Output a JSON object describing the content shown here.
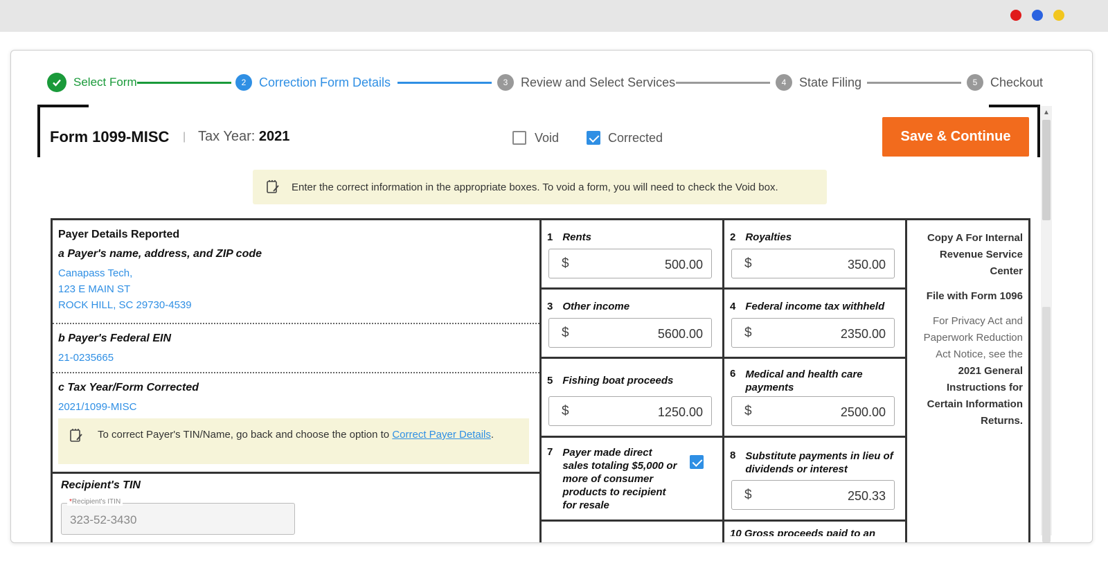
{
  "stepper": {
    "steps": [
      {
        "num": "1",
        "label": "Select Form"
      },
      {
        "num": "2",
        "label": "Correction Form Details"
      },
      {
        "num": "3",
        "label": "Review and Select Services"
      },
      {
        "num": "4",
        "label": "State Filing"
      },
      {
        "num": "5",
        "label": "Checkout"
      }
    ]
  },
  "header": {
    "form_title": "Form 1099-MISC",
    "separator": "|",
    "tax_year_label": "Tax Year:",
    "tax_year_value": "2021",
    "void_label": "Void",
    "corrected_label": "Corrected",
    "save_label": "Save & Continue"
  },
  "notice": "Enter the correct information in the appropriate boxes. To void a form, you will need to check the Void box.",
  "payer": {
    "section_title": "Payer Details Reported",
    "name_label": "a Payer's name, address, and ZIP code",
    "name_line1": "Canapass Tech,",
    "name_line2": "123 E MAIN ST",
    "name_line3": "ROCK HILL, SC 29730-4539",
    "ein_label": "b Payer's Federal EIN",
    "ein_value": "21-0235665",
    "corrected_label": "c Tax Year/Form Corrected",
    "corrected_value": "2021/1099-MISC",
    "tin_note_text": "To correct Payer's TIN/Name, go back and choose the option to",
    "tin_note_link": "Correct Payer Details",
    "tin_note_end": "."
  },
  "recipient": {
    "tin_label": "Recipient's TIN",
    "field_asterisk": "*",
    "field_label": "Recipient's ITIN",
    "field_value": "323-52-3430"
  },
  "boxes": {
    "currency": "$",
    "b1": {
      "num": "1",
      "label": "Rents",
      "value": "500.00"
    },
    "b2": {
      "num": "2",
      "label": "Royalties",
      "value": "350.00"
    },
    "b3": {
      "num": "3",
      "label": "Other income",
      "value": "5600.00"
    },
    "b4": {
      "num": "4",
      "label": "Federal income tax withheld",
      "value": "2350.00"
    },
    "b5": {
      "num": "5",
      "label": "Fishing boat proceeds",
      "value": "1250.00"
    },
    "b6": {
      "num": "6",
      "label": "Medical and health care payments",
      "value": "2500.00"
    },
    "b7": {
      "num": "7",
      "label": "Payer made direct sales totaling $5,000 or more of consumer products to recipient for resale",
      "checked": true
    },
    "b8": {
      "num": "8",
      "label": "Substitute payments in lieu of dividends or interest",
      "value": "250.33"
    },
    "b10": {
      "label": "10 Gross proceeds paid to an"
    }
  },
  "copy_panel": {
    "line1": "Copy A For Internal Revenue Service Center",
    "line2": "File with Form 1096",
    "line3a": "For Privacy Act and Paperwork Reduction Act Notice, see the",
    "line3b": "2021 General Instructions for Certain Information Returns."
  },
  "colors": {
    "accent_green": "#1a9a3a",
    "accent_blue": "#2f8fe4",
    "save_orange": "#f26b1d",
    "notice_bg": "#f6f4d9"
  }
}
